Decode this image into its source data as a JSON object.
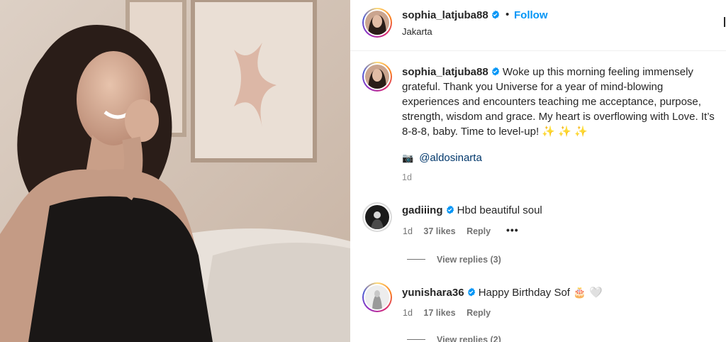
{
  "post": {
    "author": "sophia_latjuba88",
    "follow_label": "Follow",
    "separator": "•",
    "location": "Jakarta",
    "caption": "Woke up this morning feeling immensely grateful. Thank you Universe for a year of mind-blowing experiences and encounters teaching me acceptance, purpose, strength, wisdom and grace. My heart is overflowing with Love. It’s 8-8-8, baby. Time to level-up! ✨ ✨ ✨",
    "photo_credit_icon": "📷",
    "photo_credit": "@aldosinarta",
    "time": "1d"
  },
  "comments": [
    {
      "user": "gadiiing",
      "text": "Hbd beautiful soul",
      "time": "1d",
      "likes": "37 likes",
      "reply_label": "Reply",
      "more_label": "•••",
      "view_replies": "View replies (3)"
    },
    {
      "user": "yunishara36",
      "text": "Happy Birthday Sof 🎂 🤍",
      "time": "1d",
      "likes": "17 likes",
      "reply_label": "Reply",
      "view_replies": "View replies (2)"
    }
  ],
  "colors": {
    "link_blue": "#0095f6",
    "mention_blue": "#00376b",
    "verified_blue": "#0095f6",
    "secondary_text": "#737373"
  },
  "icons": {
    "verified": "verified-badge-icon",
    "camera": "camera-emoji-icon"
  }
}
